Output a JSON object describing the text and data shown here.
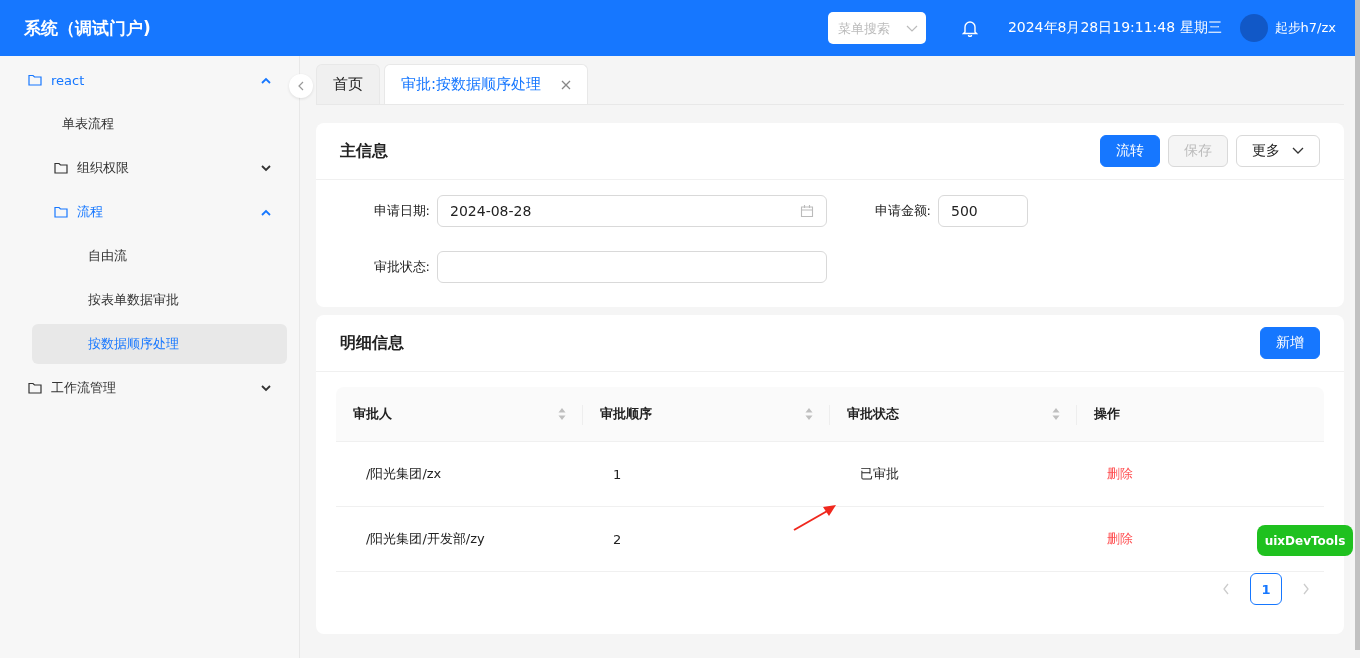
{
  "header": {
    "title": "系统（调试门户)",
    "menu_search": {
      "placeholder": "菜单搜索"
    },
    "datetime": "2024年8月28日19:11:48 星期三",
    "user": "起步h7/zx"
  },
  "sidebar": {
    "items": [
      {
        "label": "react",
        "kind": "folder",
        "expanded": true,
        "children": [
          {
            "label": "单表流程",
            "kind": "leaf",
            "selected": false
          },
          {
            "label": "组织权限",
            "kind": "folder",
            "expanded": false
          },
          {
            "label": "流程",
            "kind": "folder",
            "expanded": true,
            "children": [
              {
                "label": "自由流",
                "kind": "leaf",
                "selected": false
              },
              {
                "label": "按表单数据审批",
                "kind": "leaf",
                "selected": false
              },
              {
                "label": "按数据顺序处理",
                "kind": "leaf",
                "selected": true
              }
            ]
          }
        ]
      },
      {
        "label": "工作流管理",
        "kind": "folder",
        "expanded": false
      }
    ]
  },
  "tabs": [
    {
      "label": "首页",
      "selected": false,
      "closable": false
    },
    {
      "label": "审批:按数据顺序处理",
      "selected": true,
      "closable": true
    }
  ],
  "main_info": {
    "title": "主信息",
    "buttons": [
      {
        "label": "流转",
        "kind": "primary",
        "disabled": false
      },
      {
        "label": "保存",
        "kind": "default",
        "disabled": true
      },
      {
        "label": "更多",
        "kind": "dropdown",
        "disabled": false
      }
    ],
    "fields": [
      {
        "label": "申请日期:",
        "value": "2024-08-28",
        "kind": "date"
      },
      {
        "label": "申请金额:",
        "value": "500",
        "kind": "number"
      },
      {
        "label": "审批状态:",
        "kind": "text"
      }
    ]
  },
  "detail_info": {
    "title": "明细信息",
    "add_button": "新增",
    "table": {
      "columns": [
        {
          "label": "审批人",
          "sortable": true
        },
        {
          "label": "审批顺序",
          "sortable": true
        },
        {
          "label": "审批状态",
          "sortable": true
        },
        {
          "label": "操作",
          "sortable": false
        }
      ],
      "rows": [
        {
          "approver": "/阳光集团/zx",
          "order": "1",
          "status": "已审批",
          "action": "删除"
        },
        {
          "approver": "/阳光集团/开发部/zy",
          "order": "2",
          "action": "删除"
        }
      ]
    },
    "pagination": {
      "pages": [
        {
          "label": "1",
          "selected": true
        }
      ]
    }
  },
  "devtools_badge": "uixDevTools"
}
